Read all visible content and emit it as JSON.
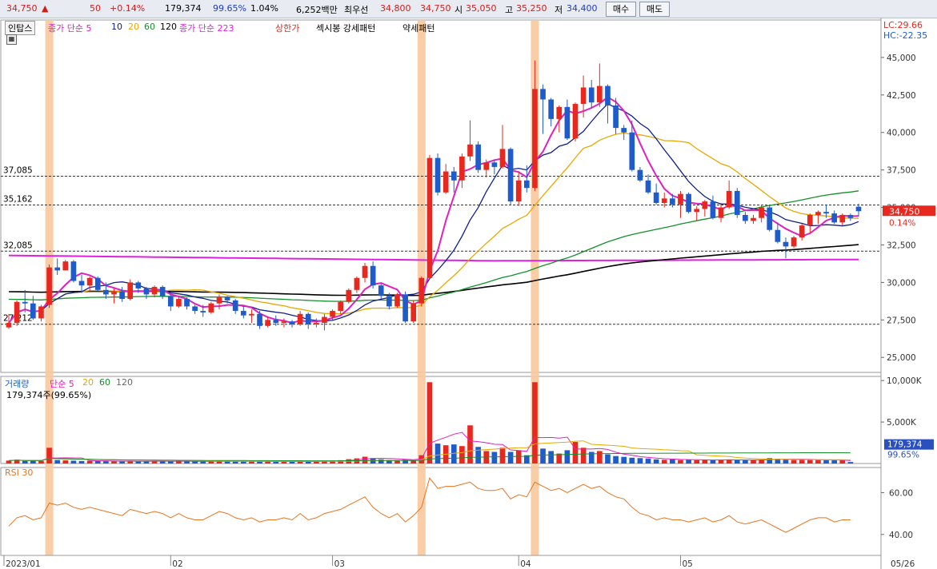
{
  "topbar": {
    "price": "34,750",
    "arrow": "▲",
    "change": "50",
    "change_pct": "+0.14%",
    "volume": "179,374",
    "vol_ratio": "99.65%",
    "turnover": "1.04%",
    "amount": "6,252백만",
    "best_label": "최우선",
    "ask": "34,800",
    "bid": "34,750",
    "open_label": "시",
    "open": "35,050",
    "high_label": "고",
    "high": "35,250",
    "low_label": "저",
    "low": "34,400",
    "buy_label": "매수",
    "sell_label": "매도"
  },
  "legend": {
    "tab": "인탑스",
    "ma_label": "종가 단순 5",
    "ma10": "10",
    "ma20": "20",
    "ma60": "60",
    "ma120": "120",
    "ma223": "종가 단순 223",
    "limit_up": "상한가",
    "pattern1": "섹시봉 강세패턴",
    "pattern2": "약세패턴",
    "lc": "LC:29.66",
    "hc": "HC:-22.35",
    "vol_title": "거래량",
    "vol_ma": "단순 5",
    "vol_ma20": "20",
    "vol_ma60": "60",
    "vol_ma120": "120",
    "vol_current": "179,374주(99.65%)",
    "rsi_title": "RSI 30"
  },
  "colors": {
    "up": "#e8281e",
    "down": "#1e5ccc",
    "ma5": "#e020c0",
    "ma10": "#10208a",
    "ma20": "#e8a800",
    "ma60": "#13902a",
    "ma120": "#000000",
    "ma223": "#e020e0",
    "rsi": "#e8741e",
    "highlight": "#f8c89c"
  },
  "chart_data": {
    "type": "candlestick",
    "y_ticks": [
      "45,000",
      "42,500",
      "40,000",
      "37,500",
      "35,000",
      "32,500",
      "30,000",
      "27,500",
      "25,000"
    ],
    "ylim": [
      24000,
      47500
    ],
    "ref_lines": [
      {
        "label": "37,085",
        "value": 37085
      },
      {
        "label": "35,162",
        "value": 35162
      },
      {
        "label": "32,085",
        "value": 32085
      },
      {
        "label": "27,212",
        "value": 27212
      }
    ],
    "x_labels": [
      {
        "label": "2023/01",
        "index": 0
      },
      {
        "label": "02",
        "index": 20
      },
      {
        "label": "03",
        "index": 40
      },
      {
        "label": "04",
        "index": 63
      },
      {
        "label": "05",
        "index": 83
      },
      {
        "label": "05/26",
        "index": 100
      }
    ],
    "highlight_indices": [
      5,
      51,
      65
    ],
    "current_price": {
      "label": "34,750",
      "pct": "0.14%",
      "value": 34750
    },
    "candles": [
      [
        27000,
        27900,
        26900,
        27300
      ],
      [
        27300,
        28800,
        27100,
        28700
      ],
      [
        28700,
        29500,
        28000,
        28600
      ],
      [
        28600,
        29100,
        27500,
        27600
      ],
      [
        27600,
        28500,
        27400,
        28400
      ],
      [
        28500,
        31200,
        28300,
        31000
      ],
      [
        31000,
        31600,
        30500,
        30800
      ],
      [
        30800,
        31500,
        30800,
        31400
      ],
      [
        31400,
        31500,
        30000,
        30100
      ],
      [
        30100,
        30500,
        29300,
        29800
      ],
      [
        29800,
        30400,
        29400,
        30300
      ],
      [
        30300,
        30400,
        29400,
        29500
      ],
      [
        29500,
        30000,
        28900,
        29200
      ],
      [
        29200,
        29600,
        28600,
        29400
      ],
      [
        29400,
        29700,
        28700,
        28900
      ],
      [
        28900,
        30200,
        28800,
        30000
      ],
      [
        30000,
        30100,
        29300,
        29600
      ],
      [
        29600,
        29700,
        28900,
        29200
      ],
      [
        29200,
        29800,
        29000,
        29700
      ],
      [
        29700,
        29800,
        28900,
        29100
      ],
      [
        29100,
        29200,
        28100,
        28400
      ],
      [
        28400,
        29100,
        28300,
        28900
      ],
      [
        28900,
        29000,
        28200,
        28400
      ],
      [
        28400,
        28500,
        27900,
        28100
      ],
      [
        28100,
        28500,
        27700,
        28000
      ],
      [
        28000,
        28700,
        27900,
        28600
      ],
      [
        28600,
        29200,
        28200,
        29000
      ],
      [
        29000,
        29100,
        28600,
        28800
      ],
      [
        28800,
        28900,
        27900,
        28100
      ],
      [
        28100,
        28400,
        27600,
        27800
      ],
      [
        27800,
        28200,
        27300,
        27900
      ],
      [
        27900,
        28100,
        26900,
        27100
      ],
      [
        27100,
        27700,
        27000,
        27500
      ],
      [
        27500,
        27800,
        27100,
        27300
      ],
      [
        27300,
        27600,
        27000,
        27400
      ],
      [
        27400,
        27500,
        27000,
        27200
      ],
      [
        27200,
        28100,
        27100,
        27900
      ],
      [
        27900,
        28000,
        26900,
        27200
      ],
      [
        27200,
        27600,
        27000,
        27300
      ],
      [
        27300,
        27900,
        26800,
        27700
      ],
      [
        27700,
        28200,
        27500,
        28100
      ],
      [
        28100,
        28800,
        27900,
        28700
      ],
      [
        28700,
        29600,
        28600,
        29500
      ],
      [
        29500,
        30400,
        29300,
        30300
      ],
      [
        30300,
        31300,
        30000,
        31100
      ],
      [
        31100,
        31400,
        29600,
        29800
      ],
      [
        29800,
        29900,
        28900,
        29100
      ],
      [
        29100,
        29300,
        28200,
        28400
      ],
      [
        28400,
        29300,
        28300,
        29200
      ],
      [
        29200,
        29400,
        27300,
        27400
      ],
      [
        27400,
        28800,
        27300,
        28600
      ],
      [
        28600,
        30400,
        28400,
        30300
      ],
      [
        30300,
        38500,
        30200,
        38300
      ],
      [
        38300,
        38600,
        35800,
        36000
      ],
      [
        36000,
        37900,
        35900,
        37400
      ],
      [
        37400,
        37700,
        36000,
        36800
      ],
      [
        36800,
        38600,
        36300,
        38400
      ],
      [
        38400,
        40800,
        38100,
        39200
      ],
      [
        39200,
        39400,
        37300,
        37500
      ],
      [
        37500,
        38200,
        37000,
        38000
      ],
      [
        38000,
        38200,
        37200,
        37700
      ],
      [
        37700,
        40500,
        37600,
        38900
      ],
      [
        38900,
        39000,
        35200,
        35400
      ],
      [
        35400,
        37400,
        35100,
        36800
      ],
      [
        36800,
        37800,
        36000,
        36300
      ],
      [
        36300,
        44800,
        36100,
        42900
      ],
      [
        42900,
        43200,
        39900,
        42200
      ],
      [
        42200,
        42300,
        40400,
        40900
      ],
      [
        40900,
        41800,
        40000,
        41700
      ],
      [
        41700,
        42200,
        39500,
        39600
      ],
      [
        39600,
        42000,
        39400,
        41900
      ],
      [
        41900,
        43800,
        41000,
        43000
      ],
      [
        43000,
        43500,
        41600,
        42000
      ],
      [
        42000,
        44600,
        41700,
        43100
      ],
      [
        43100,
        43200,
        40600,
        41800
      ],
      [
        41800,
        42300,
        39900,
        40300
      ],
      [
        40300,
        40500,
        39500,
        40000
      ],
      [
        40000,
        40800,
        37400,
        37500
      ],
      [
        37500,
        37700,
        36700,
        36800
      ],
      [
        36800,
        37200,
        35900,
        36000
      ],
      [
        36000,
        36600,
        35200,
        35300
      ],
      [
        35300,
        36000,
        35000,
        35600
      ],
      [
        35600,
        35900,
        35000,
        35200
      ],
      [
        35200,
        36100,
        34300,
        35900
      ],
      [
        35900,
        36000,
        34600,
        34700
      ],
      [
        34700,
        35100,
        34100,
        34900
      ],
      [
        34900,
        35500,
        34400,
        35400
      ],
      [
        35400,
        35800,
        34200,
        34300
      ],
      [
        34300,
        35300,
        34000,
        35000
      ],
      [
        35000,
        36800,
        34900,
        36100
      ],
      [
        36100,
        36300,
        34300,
        34500
      ],
      [
        34500,
        34700,
        33900,
        34100
      ],
      [
        34100,
        34500,
        33900,
        34300
      ],
      [
        34300,
        35200,
        34000,
        35000
      ],
      [
        35000,
        35100,
        33400,
        33500
      ],
      [
        33500,
        34000,
        32600,
        32700
      ],
      [
        32700,
        33000,
        31600,
        32400
      ],
      [
        32400,
        33100,
        32300,
        33000
      ],
      [
        33000,
        33900,
        32800,
        33800
      ],
      [
        33800,
        34600,
        33300,
        34500
      ],
      [
        34500,
        34800,
        33900,
        34700
      ],
      [
        34700,
        35200,
        34300,
        34600
      ],
      [
        34600,
        34800,
        33900,
        34000
      ],
      [
        34000,
        34600,
        33800,
        34500
      ],
      [
        34500,
        34600,
        34100,
        34300
      ],
      [
        35050,
        35250,
        34400,
        34750
      ]
    ],
    "volume_ticks": [
      "10,000K",
      "5,000K"
    ],
    "volume_ylim": [
      0,
      10500
    ],
    "volume_label": {
      "value": "179,374",
      "pct": "99.65%"
    },
    "volume": [
      350,
      450,
      300,
      380,
      320,
      1900,
      420,
      380,
      340,
      300,
      320,
      300,
      280,
      260,
      250,
      300,
      280,
      260,
      300,
      270,
      260,
      320,
      250,
      240,
      230,
      260,
      290,
      260,
      250,
      240,
      260,
      280,
      250,
      220,
      230,
      220,
      300,
      250,
      230,
      300,
      320,
      400,
      520,
      620,
      820,
      650,
      500,
      430,
      430,
      520,
      400,
      1000,
      9800,
      2400,
      2200,
      2300,
      2100,
      4600,
      2000,
      1500,
      1400,
      1900,
      1400,
      1600,
      1000,
      9800,
      1800,
      1500,
      1200,
      1600,
      2600,
      1900,
      1400,
      1500,
      1100,
      900,
      800,
      700,
      650,
      600,
      500,
      450,
      500,
      420,
      480,
      400,
      420,
      410,
      440,
      500,
      420,
      380,
      400,
      460,
      650,
      580,
      500,
      420,
      460,
      480,
      440,
      400,
      380,
      380,
      179
    ],
    "rsi_ticks": [
      "60.00",
      "40.00"
    ],
    "rsi_ylim": [
      30,
      72
    ],
    "rsi": [
      44,
      48,
      49,
      47,
      48,
      55,
      54,
      55,
      53,
      52,
      53,
      52,
      51,
      50,
      49,
      52,
      51,
      50,
      51,
      50,
      48,
      50,
      48,
      47,
      47,
      49,
      51,
      50,
      48,
      47,
      48,
      46,
      47,
      47,
      48,
      47,
      50,
      47,
      48,
      50,
      51,
      52,
      54,
      56,
      58,
      53,
      50,
      48,
      50,
      46,
      49,
      53,
      67,
      62,
      63,
      63,
      64,
      65,
      62,
      61,
      61,
      62,
      57,
      59,
      58,
      65,
      63,
      61,
      62,
      60,
      62,
      64,
      62,
      63,
      60,
      58,
      57,
      53,
      50,
      49,
      47,
      48,
      47,
      47,
      46,
      47,
      48,
      46,
      47,
      49,
      46,
      45,
      46,
      47,
      45,
      43,
      41,
      43,
      45,
      47,
      48,
      48,
      46,
      47,
      47
    ]
  }
}
